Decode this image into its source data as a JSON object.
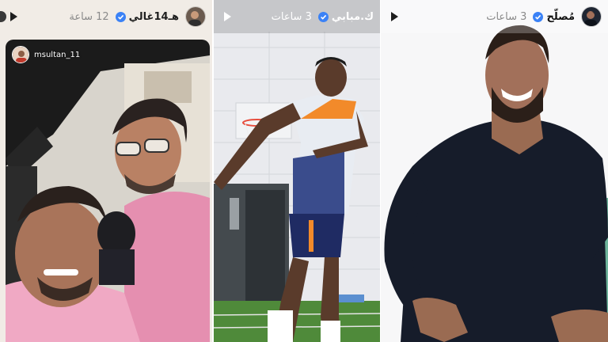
{
  "stories": [
    {
      "username": "هـ14غالي",
      "time": "12 ساعة",
      "verified": true,
      "inner_username": "msultan_11"
    },
    {
      "username": "ك.مبابي",
      "time": "3 ساعات",
      "verified": true
    },
    {
      "username": "مُصلّح",
      "time": "3 ساعات",
      "verified": true
    }
  ],
  "colors": {
    "verified_badge": "#3b82f6",
    "field_green": "#4f8a3a",
    "pink_shirt": "#e58fb0",
    "jersey_orange": "#f28a2a"
  },
  "icons": {
    "play": "play-icon",
    "verified": "verified-badge-icon"
  }
}
